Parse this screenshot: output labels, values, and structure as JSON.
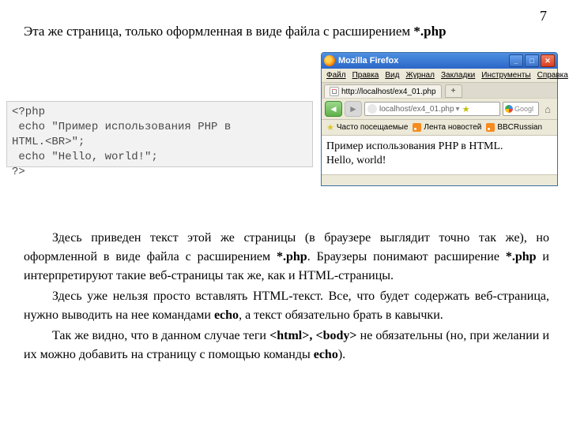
{
  "page_number": "7",
  "heading": {
    "pre": "Эта же страница, только оформленная в виде файла с расширением ",
    "ext": "*.php"
  },
  "code": "<?php\n echo \"Пример использования PHP в\nHTML.<BR>\";\n echo \"Hello, world!\";\n?>",
  "browser": {
    "app_title": "Mozilla Firefox",
    "win_min": "_",
    "win_max": "□",
    "win_close": "✕",
    "menus": [
      "Файл",
      "Правка",
      "Вид",
      "Журнал",
      "Закладки",
      "Инструменты",
      "Справка"
    ],
    "tab_label": "http://localhost/ex4_01.php",
    "tab_plus": "+",
    "back": "◄",
    "fwd": "►",
    "url": "localhost/ex4_01.php",
    "search_placeholder": "Googl",
    "home": "⌂",
    "bookmarks": {
      "most": "Часто посещаемые",
      "news": "Лента новостей",
      "bbc": "BBCRussian"
    },
    "page_line1": "Пример использования PHP в HTML.",
    "page_line2": "Hello, world!"
  },
  "paragraphs": {
    "p1a": "Здесь приведен  текст  этой  же  страницы (в браузере  выглядит  точно  так  же), но   оформленной   в   виде  файла   с   расширением  ",
    "p1_ext": "*.php",
    "p1b": ".  Браузеры понимают расширение ",
    "p1_ext2": "*.php",
    "p1c": " и  интерпретируют   такие   веб-страницы так же, как и HTML-страницы.",
    "p2a": "Здесь  уже  нельзя  просто  вставлять HTML-текст.  Все,  что  будет  содержать веб-страница,  нужно выводить на нее командами ",
    "p2_echo": "echo",
    "p2b": ", а текст обязательно брать в кавычки.",
    "p3a": "Так же видно, что в данном случае теги ",
    "p3_html": "<html>,",
    "p3_body": " <body>",
    "p3b": " не  обязательны (но, при  желании  и  их  можно  добавить на страницу с помощью команды ",
    "p3_echo": "echo",
    "p3c": ")."
  }
}
